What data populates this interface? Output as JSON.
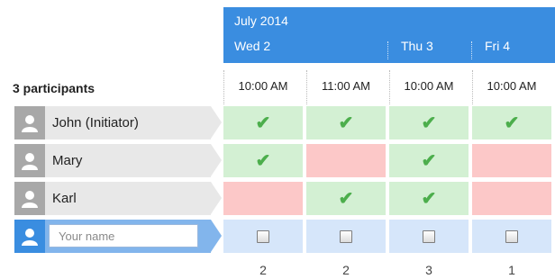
{
  "header": {
    "month": "July 2014"
  },
  "days": [
    {
      "label": "Wed 2"
    },
    {
      "label": "Thu 3"
    },
    {
      "label": "Fri 4"
    }
  ],
  "times": [
    "10:00 AM",
    "11:00 AM",
    "10:00 AM",
    "10:00 AM"
  ],
  "participants_label": "3 participants",
  "participants": [
    {
      "name": "John (Initiator)",
      "votes": [
        "yes",
        "yes",
        "yes",
        "yes"
      ]
    },
    {
      "name": "Mary",
      "votes": [
        "yes",
        "no",
        "yes",
        "no"
      ]
    },
    {
      "name": "Karl",
      "votes": [
        "no",
        "yes",
        "yes",
        "no"
      ]
    }
  ],
  "new_participant": {
    "placeholder": "Your name"
  },
  "counts": [
    "2",
    "2",
    "3",
    "1"
  ],
  "colors": {
    "accent": "#3a8de0",
    "yes": "#d3f0d3",
    "no": "#fcc8c8",
    "check": "#4cae4c"
  },
  "icons": {
    "avatar": "person-icon",
    "vote": "checkmark-icon"
  }
}
